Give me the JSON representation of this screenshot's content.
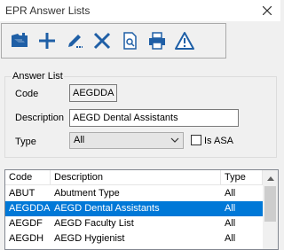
{
  "window": {
    "title": "EPR Answer Lists",
    "close_icon": "close-icon"
  },
  "toolbar": {
    "buttons": [
      {
        "name": "open-list-icon"
      },
      {
        "name": "add-icon"
      },
      {
        "name": "edit-icon"
      },
      {
        "name": "delete-icon"
      },
      {
        "name": "preview-icon"
      },
      {
        "name": "print-icon"
      },
      {
        "name": "warning-icon"
      }
    ]
  },
  "answer_list": {
    "group_label": "Answer List",
    "code_label": "Code",
    "code_value": "AEGDDA",
    "description_label": "Description",
    "description_value": "AEGD Dental Assistants",
    "type_label": "Type",
    "type_value": "All",
    "is_asa_label": "Is ASA",
    "is_asa_checked": false
  },
  "grid": {
    "columns": [
      "Code",
      "Description",
      "Type"
    ],
    "rows": [
      {
        "code": "ABUT",
        "description": "Abutment Type",
        "type": "All"
      },
      {
        "code": "AEGDDA",
        "description": "AEGD Dental Assistants",
        "type": "All"
      },
      {
        "code": "AEGDF",
        "description": "AEGD Faculty List",
        "type": "All"
      },
      {
        "code": "AEGDH",
        "description": "AEGD Hygienist",
        "type": "All"
      }
    ],
    "selected_index": 1
  },
  "colors": {
    "selection": "#0078d7",
    "accent_blue": "#1f5fa6"
  }
}
